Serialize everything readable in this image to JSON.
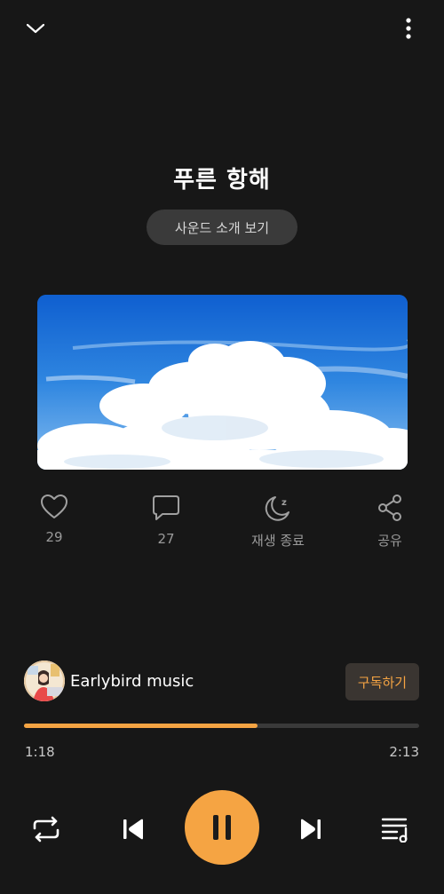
{
  "track": {
    "title": "푸른 항해",
    "intro_label": "사운드 소개 보기"
  },
  "actions": {
    "like_count": "29",
    "comment_count": "27",
    "sleep_label": "재생 종료",
    "share_label": "공유"
  },
  "channel": {
    "name": "Earlybird music",
    "subscribe_label": "구독하기"
  },
  "playback": {
    "current_time": "1:18",
    "total_time": "2:13",
    "progress": 0.59,
    "state": "playing"
  },
  "icons": {
    "collapse": "chevron-down-icon",
    "more": "more-vertical-icon",
    "like": "heart-icon",
    "comment": "comment-icon",
    "sleep": "moon-sleep-icon",
    "share": "share-icon",
    "repeat": "repeat-icon",
    "previous": "skip-previous-icon",
    "pause": "pause-icon",
    "next": "skip-next-icon",
    "playlist": "playlist-icon"
  },
  "colors": {
    "accent": "#f5a443",
    "background": "#171717"
  }
}
